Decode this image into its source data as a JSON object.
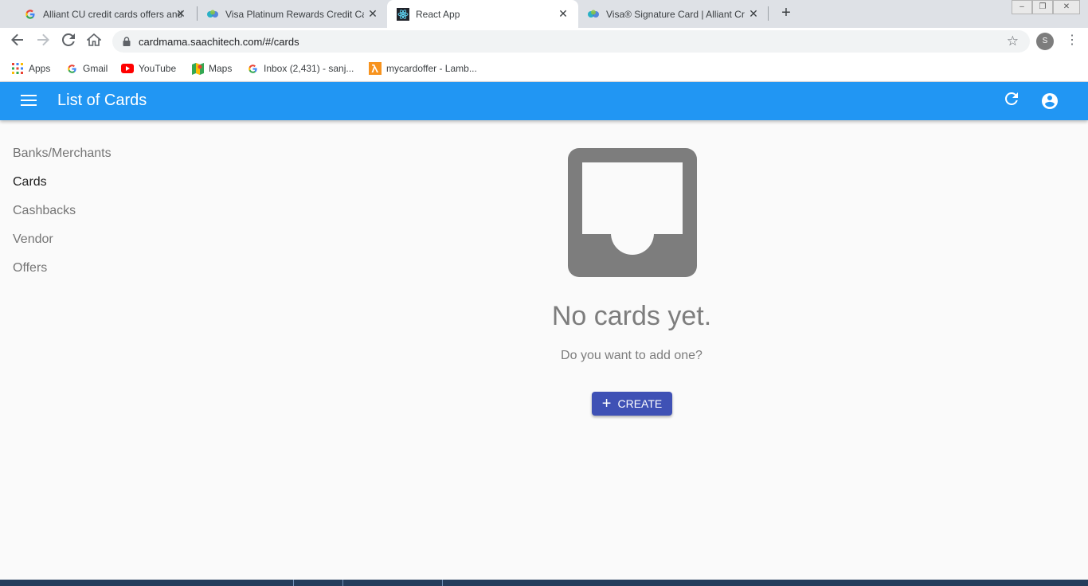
{
  "browser": {
    "tabs": [
      {
        "title": "Alliant CU credit cards offers and",
        "favicon": "google-icon"
      },
      {
        "title": "Visa Platinum Rewards Credit Car",
        "favicon": "alliant-icon"
      },
      {
        "title": "React App",
        "favicon": "react-icon"
      },
      {
        "title": "Visa® Signature Card | Alliant Cr",
        "favicon": "alliant-icon"
      }
    ],
    "url": "cardmama.saachitech.com/#/cards",
    "profile_initial": "S",
    "bookmarks": [
      {
        "label": "Apps",
        "icon": "apps-grid-icon"
      },
      {
        "label": "Gmail",
        "icon": "google-icon"
      },
      {
        "label": "YouTube",
        "icon": "youtube-icon"
      },
      {
        "label": "Maps",
        "icon": "maps-icon"
      },
      {
        "label": "Inbox (2,431) - sanj...",
        "icon": "google-icon"
      },
      {
        "label": "mycardoffer - Lamb...",
        "icon": "lambda-icon"
      }
    ]
  },
  "app": {
    "title": "List of Cards",
    "accent": "#2196f3",
    "button_color": "#3f51b5"
  },
  "sidebar": {
    "items": [
      {
        "label": "Banks/Merchants",
        "active": false
      },
      {
        "label": "Cards",
        "active": true
      },
      {
        "label": "Cashbacks",
        "active": false
      },
      {
        "label": "Vendor",
        "active": false
      },
      {
        "label": "Offers",
        "active": false
      }
    ]
  },
  "empty_state": {
    "icon": "inbox-icon",
    "title": "No cards yet.",
    "subtitle": "Do you want to add one?",
    "create_label": "CREATE"
  }
}
